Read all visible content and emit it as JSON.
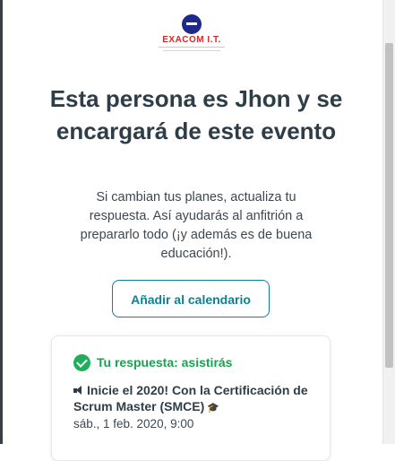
{
  "logo": {
    "text": "EXACOM I.T."
  },
  "header": {
    "title": "Esta persona es Jhon y se encargará de este evento"
  },
  "body": {
    "description": "Si cambian tus planes, actualiza tu respuesta. Así ayudarás al anfitrión a prepararlo todo (¡y además es de buena educación!)."
  },
  "actions": {
    "add_to_calendar_label": "Añadir al calendario"
  },
  "rsvp": {
    "status_label": "Tu respuesta: asistirás",
    "status_icon": "check-circle-icon",
    "status_color": "#1aa251"
  },
  "event": {
    "title": "Inicie el 2020! Con la Certificación de Scrum Master (SMCE)",
    "leading_icon": "speaker-icon",
    "trailing_icon": "graduation-cap-icon",
    "date": "sáb., 1 feb. 2020, 9:00"
  },
  "colors": {
    "accent": "#0d8290",
    "text": "#2e3e48",
    "success": "#1fae5b",
    "brand_red": "#d32a2a",
    "brand_blue": "#1d2a8a"
  }
}
